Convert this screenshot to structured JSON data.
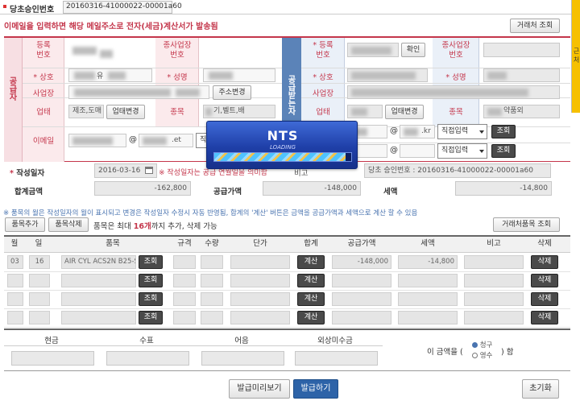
{
  "header": {
    "tab_label": "당초승인번호",
    "approval_number": "20160316-41000022-00001a60",
    "notice": "이메일을 입력하면 해당 메일주소로 전자(세금)계산서가 발송됨",
    "lookup_button": "거래처 조회"
  },
  "side_tab": "근처",
  "supplier": {
    "section_label": "공급자",
    "reg_no_label": "등록\n번호",
    "branch_label": "종사업장\n번호",
    "name_label": "상호",
    "ceo_label": "성명",
    "address_label": "사업장",
    "address_change_button": "주소변경",
    "business_label": "업태",
    "business_value": "제조,도매",
    "business_change_button": "업태변경",
    "item_label": "종목",
    "item_value": "기,벨트,배",
    "email_label": "이메일",
    "email_domain": ".et",
    "email_select": "직접"
  },
  "receiver": {
    "section_label": "공급받는자",
    "reg_no_label": "등록\n번호",
    "confirm_button": "확인",
    "branch_label": "종사업장\n번호",
    "name_label": "상호",
    "ceo_label": "성명",
    "address_label": "사업장",
    "business_label": "업태",
    "business_change_button": "업태변경",
    "item_label": "종목",
    "item_value": "약품외",
    "email_domain1": ".kr",
    "email_select1": "직접입력",
    "email_select2": "직접입력",
    "lookup_button": "조회"
  },
  "summary": {
    "date_label": "작성일자",
    "date_value": "2016-03-16",
    "date_note": "※ 작성일자는 공급 연월일을 의미함",
    "remark_label": "비고",
    "remark_value": "당초 승인번호 : 20160316-41000022-00001a60",
    "total_label": "합계금액",
    "total_value": "-162,800",
    "supply_label": "공급가액",
    "supply_value": "-148,000",
    "tax_label": "세액",
    "tax_value": "-14,800"
  },
  "items_note": "※ 품목의 월은 작성일자의 월이 표시되고 변경은 작성일자 수정시 자동 반영됨, 합계의 '계산' 버튼은 금액을 공급가액과 세액으로 계산 할 수 있음",
  "items_toolbar": {
    "add_button": "품목추가",
    "delete_button": "품목삭제",
    "limit_text_pre": "품목은 최대 ",
    "limit_count": "16개",
    "limit_text_post": "까지 추가, 삭제 가능",
    "item_lookup_button": "거래처품목 조회"
  },
  "table": {
    "headers": [
      "월",
      "일",
      "품목",
      "규격",
      "수량",
      "단가",
      "합계",
      "공급가액",
      "세액",
      "비고",
      "삭제"
    ],
    "lookup_label": "조회",
    "calc_label": "계산",
    "delete_label": "삭제",
    "rows": [
      {
        "month": "03",
        "day": "16",
        "item": "AIR CYL ACS2N B25-S",
        "supply": "-148,000",
        "tax": "-14,800"
      },
      {
        "month": "",
        "day": "",
        "item": "",
        "supply": "",
        "tax": ""
      },
      {
        "month": "",
        "day": "",
        "item": "",
        "supply": "",
        "tax": ""
      },
      {
        "month": "",
        "day": "",
        "item": "",
        "supply": "",
        "tax": ""
      }
    ]
  },
  "payment": {
    "headers": [
      "현금",
      "수표",
      "어음",
      "외상미수금"
    ],
    "amount_prefix": "이 금액을 (",
    "option_claim": "청구",
    "option_receipt": "영수",
    "amount_suffix": ") 함"
  },
  "footer": {
    "preview_button": "발급미리보기",
    "issue_button": "발급하기",
    "reset_button": "초기화"
  },
  "loading": {
    "title": "NTS",
    "subtitle": "LOADING",
    "progress": 0.96
  },
  "colors": {
    "accent_red": "#c4364b",
    "accent_blue": "#4a74b0",
    "issue_blue": "#2d63a8",
    "side_yellow": "#f6c000"
  }
}
